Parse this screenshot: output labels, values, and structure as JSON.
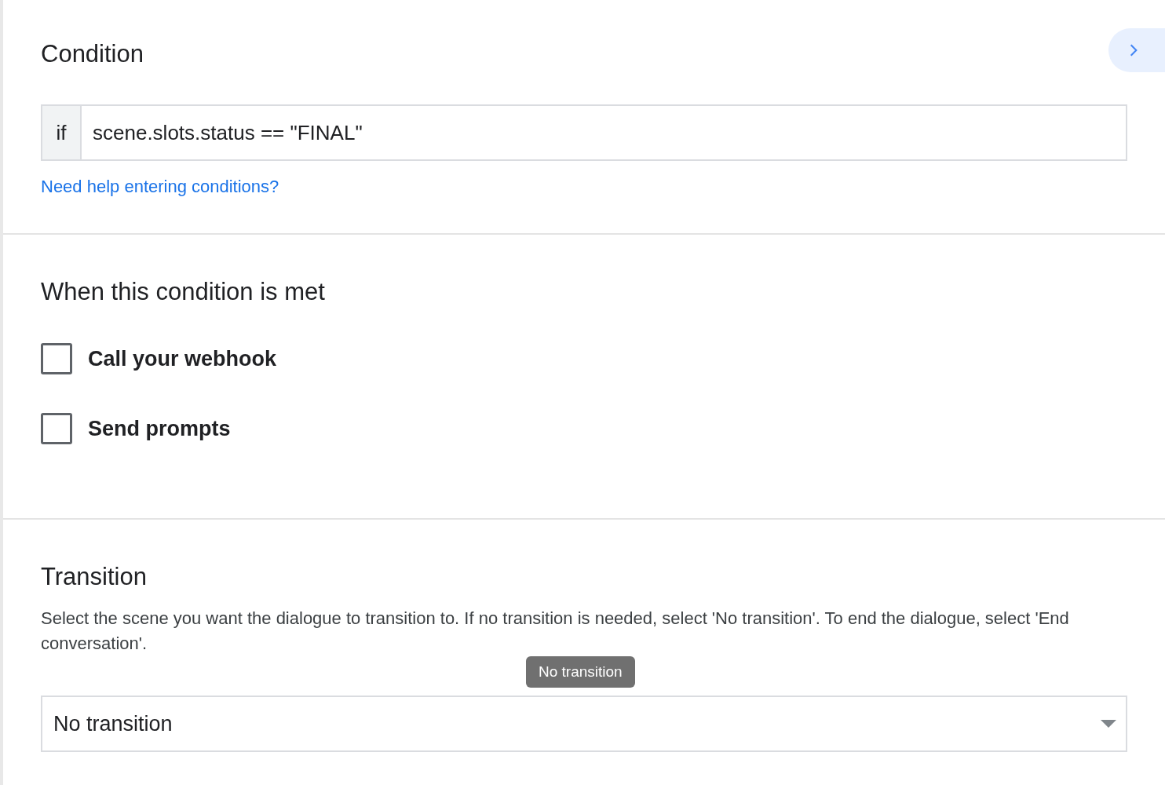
{
  "condition": {
    "title": "Condition",
    "prefix": "if",
    "value": "scene.slots.status == \"FINAL\"",
    "help_link": "Need help entering conditions?"
  },
  "actions": {
    "title": "When this condition is met",
    "options": [
      {
        "label": "Call your webhook",
        "checked": false
      },
      {
        "label": "Send prompts",
        "checked": false
      }
    ]
  },
  "transition": {
    "title": "Transition",
    "description": "Select the scene you want the dialogue to transition to. If no transition is needed, select 'No transition'. To end the dialogue, select 'End conversation'.",
    "tooltip": "No transition",
    "select_value": "No transition"
  }
}
